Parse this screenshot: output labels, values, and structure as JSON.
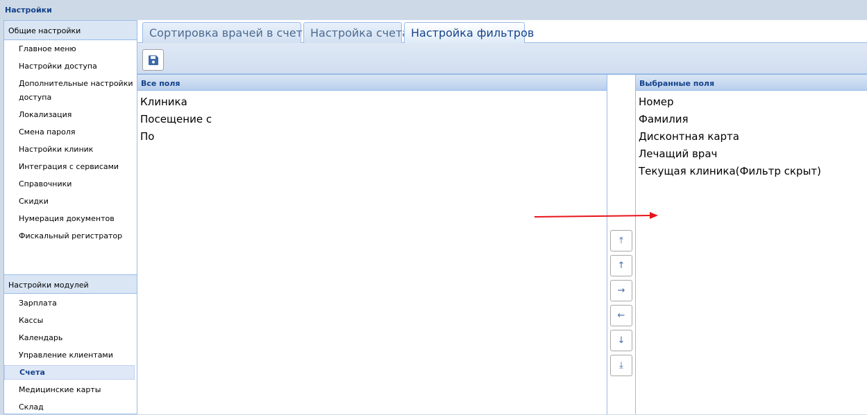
{
  "title": "Настройки",
  "sidebar": {
    "general_header": "Общие настройки",
    "general_items": [
      "Главное меню",
      "Настройки доступа",
      "Дополнительные настройки доступа",
      "Локализация",
      "Смена пароля",
      "Настройки клиник",
      "Интеграция с сервисами",
      "Справочники",
      "Скидки",
      "Нумерация документов",
      "Фискальный регистратор"
    ],
    "modules_header": "Настройки модулей",
    "module_items": [
      "Зарплата",
      "Кассы",
      "Календарь",
      "Управление клиентами",
      "Счета",
      "Медицинские карты",
      "Склад"
    ],
    "selected": "Счета"
  },
  "tabs": [
    "Сортировка врачей в счетах",
    "Настройка счета",
    "Настройка фильтров"
  ],
  "active_tab": "Настройка фильтров",
  "toolbar": {
    "save_icon": "save-icon"
  },
  "all_fields": {
    "header": "Все поля",
    "items": [
      "Клиника",
      "Посещение с",
      "По"
    ]
  },
  "selected_fields": {
    "header": "Выбранные поля",
    "items": [
      "Номер",
      "Фамилия",
      "Дисконтная карта",
      "Лечащий врач",
      "Текущая клиника(Фильтр скрыт)"
    ]
  },
  "move_buttons": [
    "move-top",
    "move-up",
    "move-right",
    "move-left",
    "move-down",
    "move-bottom"
  ],
  "annotation_color": "#e8141b"
}
